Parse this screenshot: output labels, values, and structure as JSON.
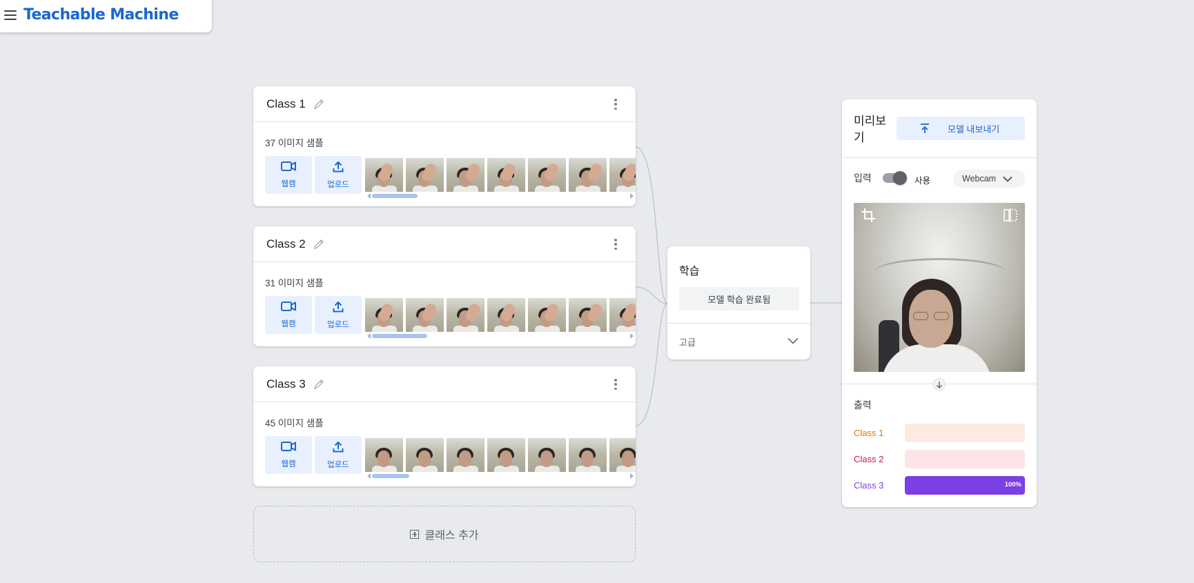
{
  "header": {
    "title": "Teachable Machine"
  },
  "classes": [
    {
      "name": "Class 1",
      "sample_count": "37 이미지 샘플",
      "webcam_label": "웹캠",
      "upload_label": "업로드",
      "gesture": "hand"
    },
    {
      "name": "Class 2",
      "sample_count": "31 이미지 샘플",
      "webcam_label": "웹캠",
      "upload_label": "업로드",
      "gesture": "hand"
    },
    {
      "name": "Class 3",
      "sample_count": "45 이미지 샘플",
      "webcam_label": "웹캠",
      "upload_label": "업로드",
      "gesture": "face"
    }
  ],
  "add_class": {
    "label": "클래스 추가"
  },
  "training": {
    "title": "학습",
    "button_label": "모델 학습 완료됨",
    "advanced_label": "고급"
  },
  "preview": {
    "title": "미리보기",
    "export_label": "모델 내보내기",
    "input_label": "입력",
    "toggle_label": "사용",
    "toggle_on": true,
    "camera_source": "Webcam",
    "output_label": "출력",
    "outputs": [
      {
        "name": "Class 1",
        "percent": 0,
        "percent_label": "",
        "color": "#e37400",
        "track": "#fdeae0"
      },
      {
        "name": "Class 2",
        "percent": 0,
        "percent_label": "",
        "color": "#c2185b",
        "track": "#fde4e6"
      },
      {
        "name": "Class 3",
        "percent": 100,
        "percent_label": "100%",
        "color": "#7b3fe4",
        "track": "#ece5fb"
      }
    ]
  },
  "colors": {
    "accent": "#1967d2",
    "background": "#e8eaed"
  }
}
